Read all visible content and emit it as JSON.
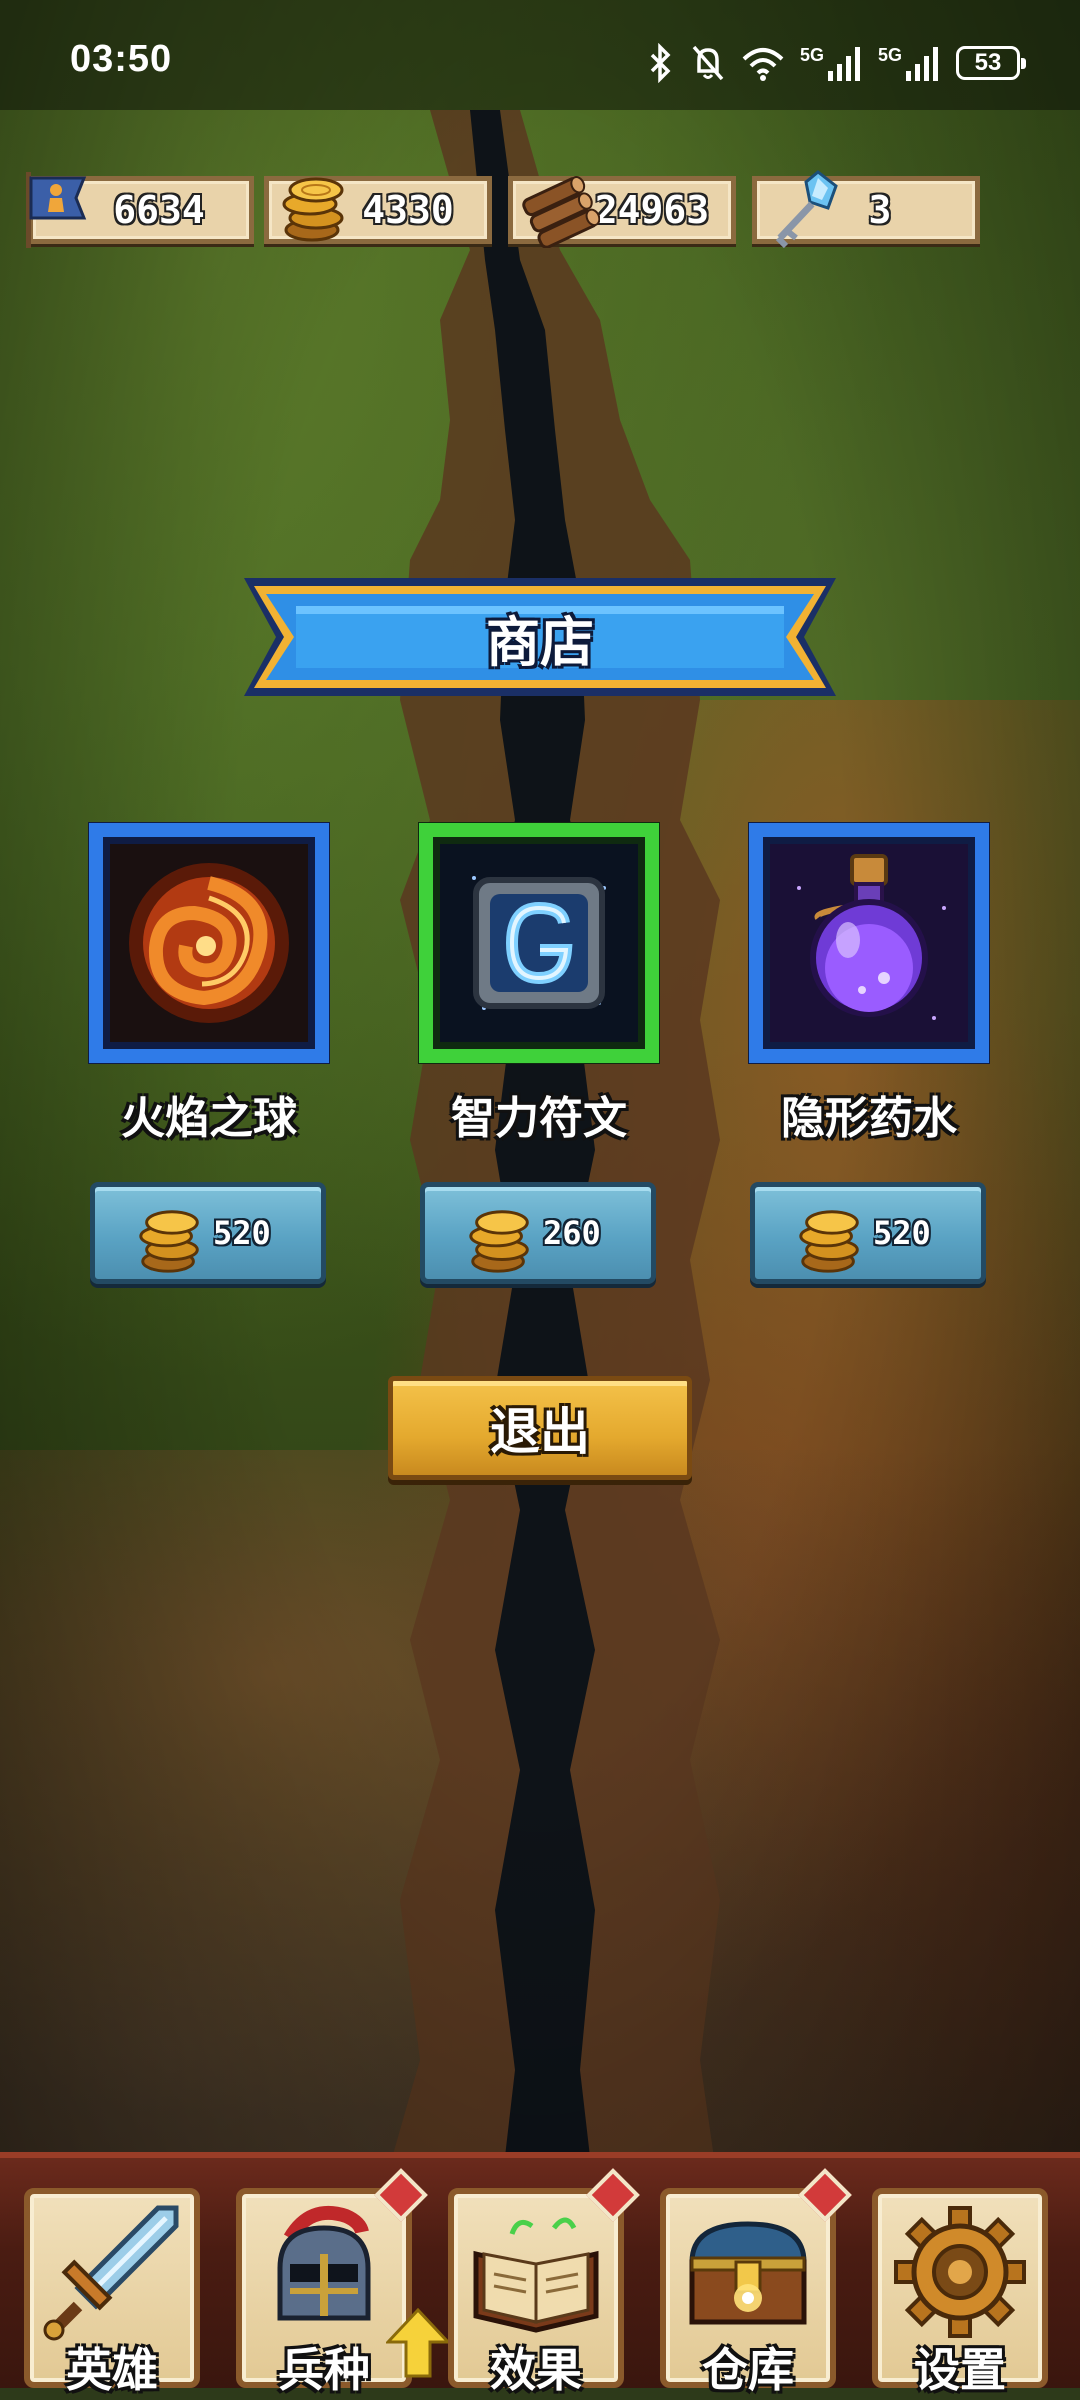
{
  "status_bar": {
    "time": "03:50",
    "network_1": "5G",
    "network_2": "5G",
    "battery": "53"
  },
  "resources": [
    {
      "id": "population",
      "icon": "population-flag-icon",
      "value": "6634"
    },
    {
      "id": "gold",
      "icon": "gold-coins-icon",
      "value": "4330"
    },
    {
      "id": "wood",
      "icon": "wood-logs-icon",
      "value": "24963"
    },
    {
      "id": "key",
      "icon": "crystal-key-icon",
      "value": "3"
    }
  ],
  "shop": {
    "title": "商店",
    "items": [
      {
        "name": "火焰之球",
        "icon": "fireball-icon",
        "frame_color": "#2f7be8",
        "price": "520"
      },
      {
        "name": "智力符文",
        "icon": "intellect-rune-icon",
        "frame_color": "#3fd13a",
        "price": "260"
      },
      {
        "name": "隐形药水",
        "icon": "invisibility-potion-icon",
        "frame_color": "#2f7be8",
        "price": "520"
      }
    ],
    "exit_label": "退出"
  },
  "bottom_nav": [
    {
      "label": "英雄",
      "icon": "sword-icon",
      "badge": false
    },
    {
      "label": "兵种",
      "icon": "knight-helmet-icon",
      "badge": true
    },
    {
      "label": "效果",
      "icon": "spellbook-icon",
      "badge": true
    },
    {
      "label": "仓库",
      "icon": "treasure-chest-icon",
      "badge": true
    },
    {
      "label": "设置",
      "icon": "gear-icon",
      "badge": false
    }
  ]
}
